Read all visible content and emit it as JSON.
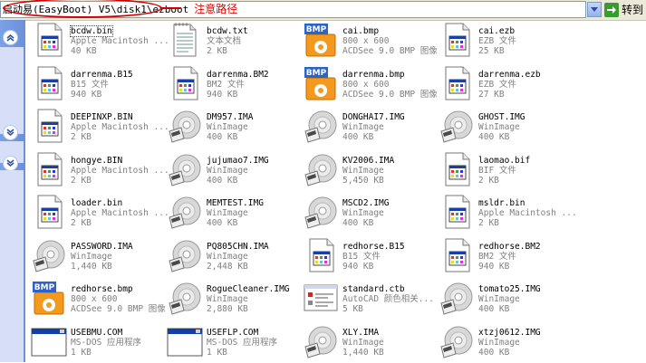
{
  "address_bar": {
    "path": "启动易(EasyBoot) V5\\disk1\\ezboot",
    "annotation": "注意路径",
    "annotation_color": "#e00000"
  },
  "go_button": {
    "label": "转到",
    "icon": "go-arrow-icon"
  },
  "task_pane": {
    "chevrons": [
      "collapse-up-icon",
      "expand-down-icon",
      "expand-down-icon"
    ]
  },
  "files": [
    {
      "name": "bcdw.bin",
      "type": "Apple Macintosh ...",
      "size": "40 KB",
      "icon": "bin-file-icon"
    },
    {
      "name": "bcdw.txt",
      "type": "文本文档",
      "size": "2 KB",
      "icon": "text-file-icon"
    },
    {
      "name": "cai.bmp",
      "type": "800 x 600",
      "size": "ACDSee 9.0 BMP 图像",
      "icon": "bmp-file-icon"
    },
    {
      "name": "cai.ezb",
      "type": "EZB 文件",
      "size": "25 KB",
      "icon": "generic-file-icon"
    },
    {
      "name": "darrenma.B15",
      "type": "B15 文件",
      "size": "940 KB",
      "icon": "generic-file-icon"
    },
    {
      "name": "darrenma.BM2",
      "type": "BM2 文件",
      "size": "940 KB",
      "icon": "generic-file-icon"
    },
    {
      "name": "darrenma.bmp",
      "type": "800 x 600",
      "size": "ACDSee 9.0 BMP 图像",
      "icon": "bmp-file-icon"
    },
    {
      "name": "darrenma.ezb",
      "type": "EZB 文件",
      "size": "27 KB",
      "icon": "generic-file-icon"
    },
    {
      "name": "DEEPINXP.BIN",
      "type": "Apple Macintosh ...",
      "size": "2 KB",
      "icon": "bin-file-icon"
    },
    {
      "name": "DM957.IMA",
      "type": "WinImage",
      "size": "400 KB",
      "icon": "disk-image-icon"
    },
    {
      "name": "DONGHAI7.IMG",
      "type": "WinImage",
      "size": "400 KB",
      "icon": "disk-image-icon"
    },
    {
      "name": "GHOST.IMG",
      "type": "WinImage",
      "size": "400 KB",
      "icon": "disk-image-icon"
    },
    {
      "name": "hongye.BIN",
      "type": "Apple Macintosh ...",
      "size": "2 KB",
      "icon": "bin-file-icon"
    },
    {
      "name": "jujumao7.IMG",
      "type": "WinImage",
      "size": "400 KB",
      "icon": "disk-image-icon"
    },
    {
      "name": "KV2006.IMA",
      "type": "WinImage",
      "size": "5,450 KB",
      "icon": "disk-image-icon"
    },
    {
      "name": "laomao.bif",
      "type": "BIF 文件",
      "size": "2 KB",
      "icon": "generic-file-icon"
    },
    {
      "name": "loader.bin",
      "type": "Apple Macintosh ...",
      "size": "2 KB",
      "icon": "bin-file-icon"
    },
    {
      "name": "MEMTEST.IMG",
      "type": "WinImage",
      "size": "400 KB",
      "icon": "disk-image-icon"
    },
    {
      "name": "MSCD2.IMG",
      "type": "WinImage",
      "size": "400 KB",
      "icon": "disk-image-icon"
    },
    {
      "name": "msldr.bin",
      "type": "Apple Macintosh ...",
      "size": "2 KB",
      "icon": "bin-file-icon"
    },
    {
      "name": "PASSWORD.IMA",
      "type": "WinImage",
      "size": "1,440 KB",
      "icon": "disk-image-icon"
    },
    {
      "name": "PQ805CHN.IMA",
      "type": "WinImage",
      "size": "2,448 KB",
      "icon": "disk-image-icon"
    },
    {
      "name": "redhorse.B15",
      "type": "B15 文件",
      "size": "940 KB",
      "icon": "generic-file-icon"
    },
    {
      "name": "redhorse.BM2",
      "type": "BM2 文件",
      "size": "940 KB",
      "icon": "generic-file-icon"
    },
    {
      "name": "redhorse.bmp",
      "type": "800 x 600",
      "size": "ACDSee 9.0 BMP 图像",
      "icon": "bmp-file-icon"
    },
    {
      "name": "RogueCleaner.IMG",
      "type": "WinImage",
      "size": "2,880 KB",
      "icon": "disk-image-icon"
    },
    {
      "name": "standard.ctb",
      "type": "AutoCAD 颜色相关...",
      "size": "5 KB",
      "icon": "ctb-file-icon"
    },
    {
      "name": "tomato25.IMG",
      "type": "WinImage",
      "size": "400 KB",
      "icon": "disk-image-icon"
    },
    {
      "name": "USEBMU.COM",
      "type": "MS-DOS 应用程序",
      "size": "1 KB",
      "icon": "dos-app-icon"
    },
    {
      "name": "USEFLP.COM",
      "type": "MS-DOS 应用程序",
      "size": "1 KB",
      "icon": "dos-app-icon"
    },
    {
      "name": "XLY.IMA",
      "type": "WinImage",
      "size": "1,440 KB",
      "icon": "disk-image-icon"
    },
    {
      "name": "xtzj0612.IMG",
      "type": "WinImage",
      "size": "400 KB",
      "icon": "disk-image-icon"
    }
  ]
}
